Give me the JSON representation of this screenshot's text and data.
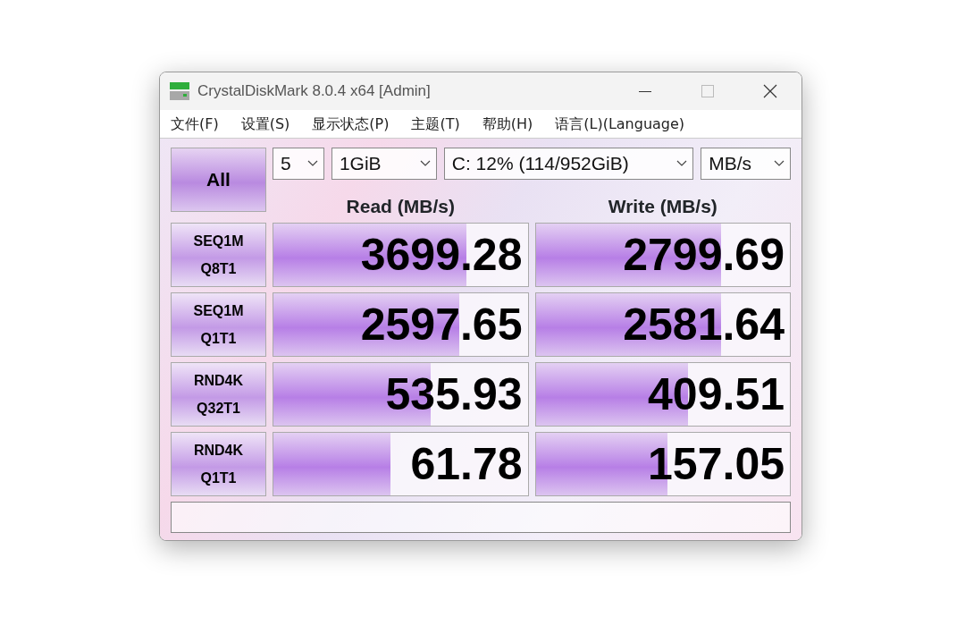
{
  "window": {
    "title": "CrystalDiskMark 8.0.4 x64 [Admin]"
  },
  "menu": [
    "文件(F)",
    "设置(S)",
    "显示状态(P)",
    "主题(T)",
    "帮助(H)",
    "语言(L)(Language)"
  ],
  "all_button": "All",
  "selects": [
    {
      "value": "5"
    },
    {
      "value": "1GiB"
    },
    {
      "value": "C: 12% (114/952GiB)"
    },
    {
      "value": "MB/s"
    }
  ],
  "columns": [
    "Read (MB/s)",
    "Write (MB/s)"
  ],
  "rows": [
    {
      "test": [
        "SEQ1M",
        "Q8T1"
      ],
      "read": {
        "value": "3699.28",
        "level": 0.76
      },
      "write": {
        "value": "2799.69",
        "level": 0.73
      }
    },
    {
      "test": [
        "SEQ1M",
        "Q1T1"
      ],
      "read": {
        "value": "2597.65",
        "level": 0.73
      },
      "write": {
        "value": "2581.64",
        "level": 0.73
      }
    },
    {
      "test": [
        "RND4K",
        "Q32T1"
      ],
      "read": {
        "value": "535.93",
        "level": 0.62
      },
      "write": {
        "value": "409.51",
        "level": 0.6
      }
    },
    {
      "test": [
        "RND4K",
        "Q1T1"
      ],
      "read": {
        "value": "61.78",
        "level": 0.46
      },
      "write": {
        "value": "157.05",
        "level": 0.52
      }
    }
  ]
}
